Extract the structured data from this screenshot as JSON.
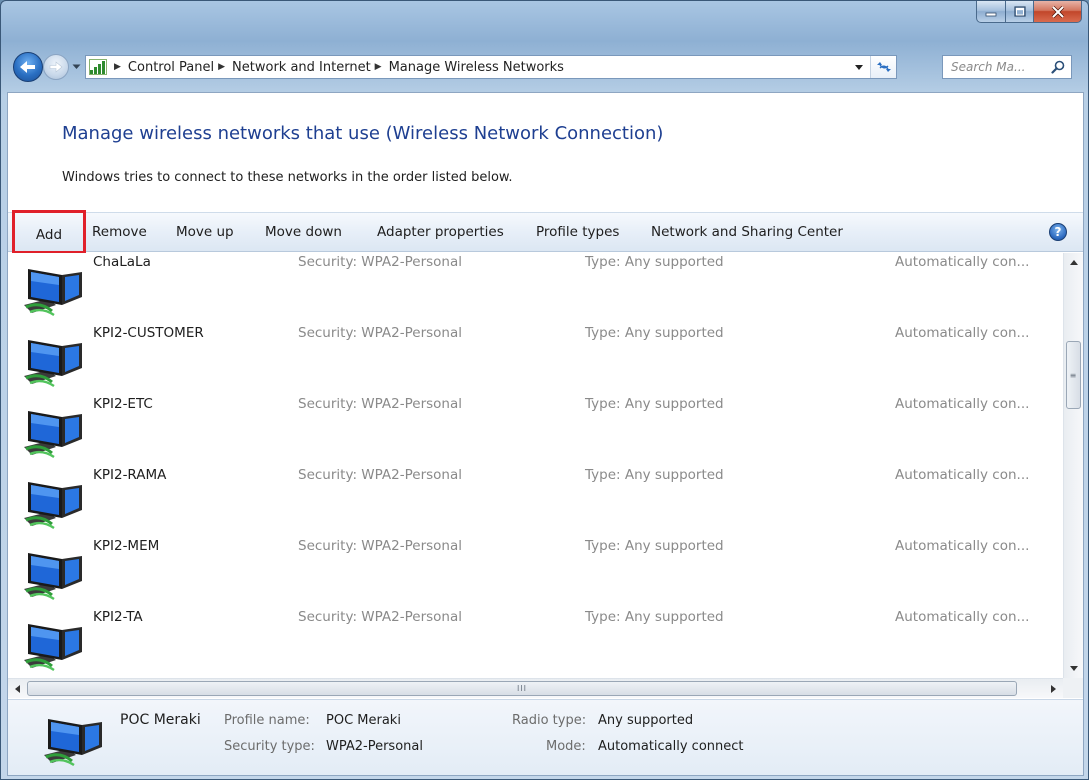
{
  "window": {
    "caption_buttons": [
      "minimize-icon",
      "maximize-icon",
      "close-icon"
    ]
  },
  "address_bar": {
    "breadcrumbs": [
      "Control Panel",
      "Network and Internet",
      "Manage Wireless Networks"
    ],
    "search_placeholder": "Search Ma..."
  },
  "main": {
    "heading": "Manage wireless networks that use (Wireless Network Connection)",
    "subheading": "Windows tries to connect to these networks in the order listed below."
  },
  "toolbar": {
    "add": "Add",
    "remove": "Remove",
    "move_up": "Move up",
    "move_down": "Move down",
    "adapter_properties": "Adapter properties",
    "profile_types": "Profile types",
    "network_sharing_center": "Network and Sharing Center",
    "help": "?"
  },
  "networks": [
    {
      "name": "ChaLaLa",
      "security": "Security: WPA2-Personal",
      "type": "Type: Any supported",
      "mode": "Automatically con..."
    },
    {
      "name": "KPI2-CUSTOMER",
      "security": "Security: WPA2-Personal",
      "type": "Type: Any supported",
      "mode": "Automatically con..."
    },
    {
      "name": "KPI2-ETC",
      "security": "Security: WPA2-Personal",
      "type": "Type: Any supported",
      "mode": "Automatically con..."
    },
    {
      "name": "KPI2-RAMA",
      "security": "Security: WPA2-Personal",
      "type": "Type: Any supported",
      "mode": "Automatically con..."
    },
    {
      "name": "KPI2-MEM",
      "security": "Security: WPA2-Personal",
      "type": "Type: Any supported",
      "mode": "Automatically con..."
    },
    {
      "name": "KPI2-TA",
      "security": "Security: WPA2-Personal",
      "type": "Type: Any supported",
      "mode": "Automatically con..."
    }
  ],
  "scrollbar": {
    "grip": "III",
    "vgrip": "≡"
  },
  "details": {
    "name": "POC Meraki",
    "profile_name_label": "Profile name:",
    "profile_name": "POC Meraki",
    "security_type_label": "Security type:",
    "security_type": "WPA2-Personal",
    "radio_type_label": "Radio type:",
    "radio_type": "Any supported",
    "mode_label": "Mode:",
    "mode": "Automatically connect"
  },
  "colors": {
    "heading": "#1e3f91",
    "highlight_border": "#e0202a",
    "muted_text": "#8a8a8a"
  }
}
